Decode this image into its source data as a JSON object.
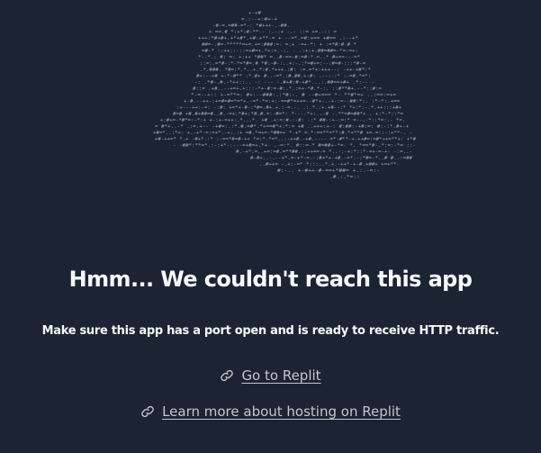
{
  "art": {
    "icon": "cloud-ascii-art",
    "char_color": "#9aa3ad"
  },
  "error": {
    "title": "Hmm... We couldn't reach this app",
    "message": "Make sure this app has a port open and is ready to receive HTTP traffic."
  },
  "links": {
    "go_to_replit": "Go to Replit",
    "learn_more": "Learn more about hosting on Replit",
    "icon": "link-icon"
  },
  "colors": {
    "background": "#1c2333",
    "text": "#f5f9fc",
    "link": "#c2c8cc"
  }
}
